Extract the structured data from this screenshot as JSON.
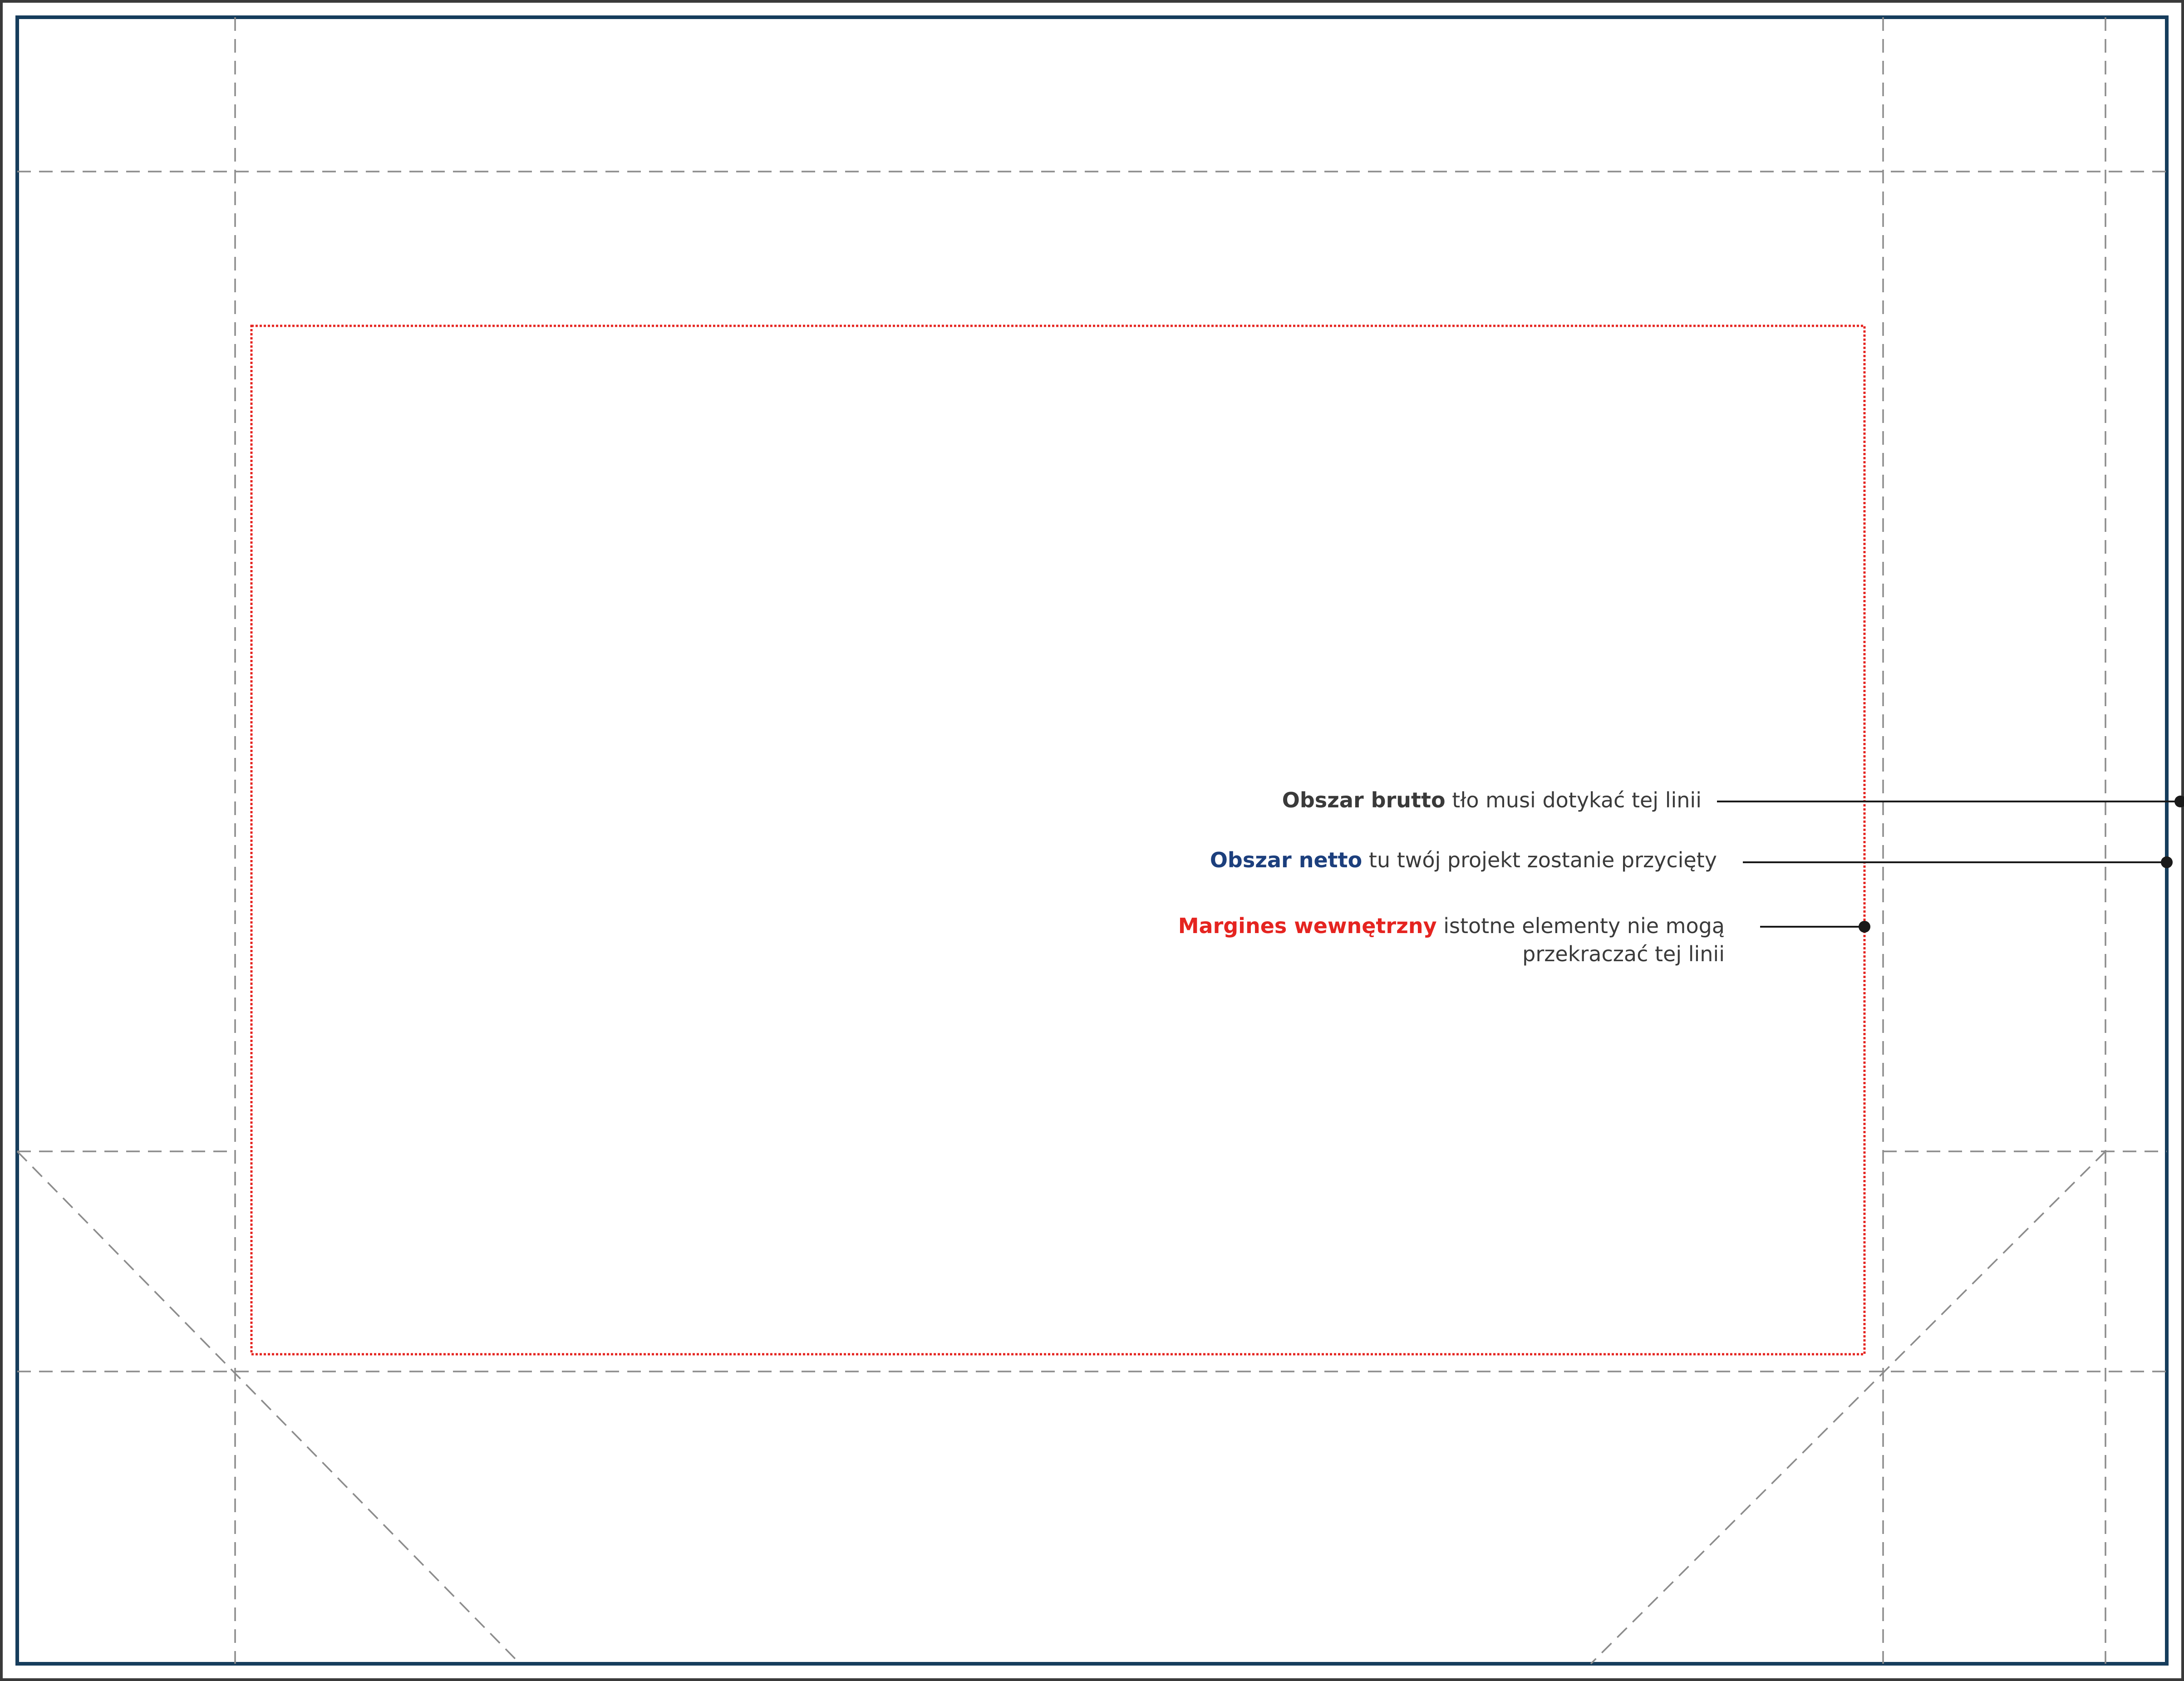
{
  "labels": {
    "brutto": {
      "title": "Obszar brutto",
      "text": "tło musi dotykać tej linii"
    },
    "netto": {
      "title": "Obszar netto",
      "text": "tu twój projekt zostanie przycięty"
    },
    "margines": {
      "title": "Margines wewnętrzny",
      "text_line1": "istotne elementy nie mogą",
      "text_line2": "przekraczać tej linii"
    }
  },
  "colors": {
    "frame_outer": "#3a3a3a",
    "netto_line": "#163d5c",
    "margin_line": "#e52420",
    "fold_lines": "#8c8c8c",
    "brutto_title": "#3a3a3a",
    "netto_title": "#1c3f7d",
    "margines_title": "#e52420",
    "body_text": "#3a3a3a"
  }
}
